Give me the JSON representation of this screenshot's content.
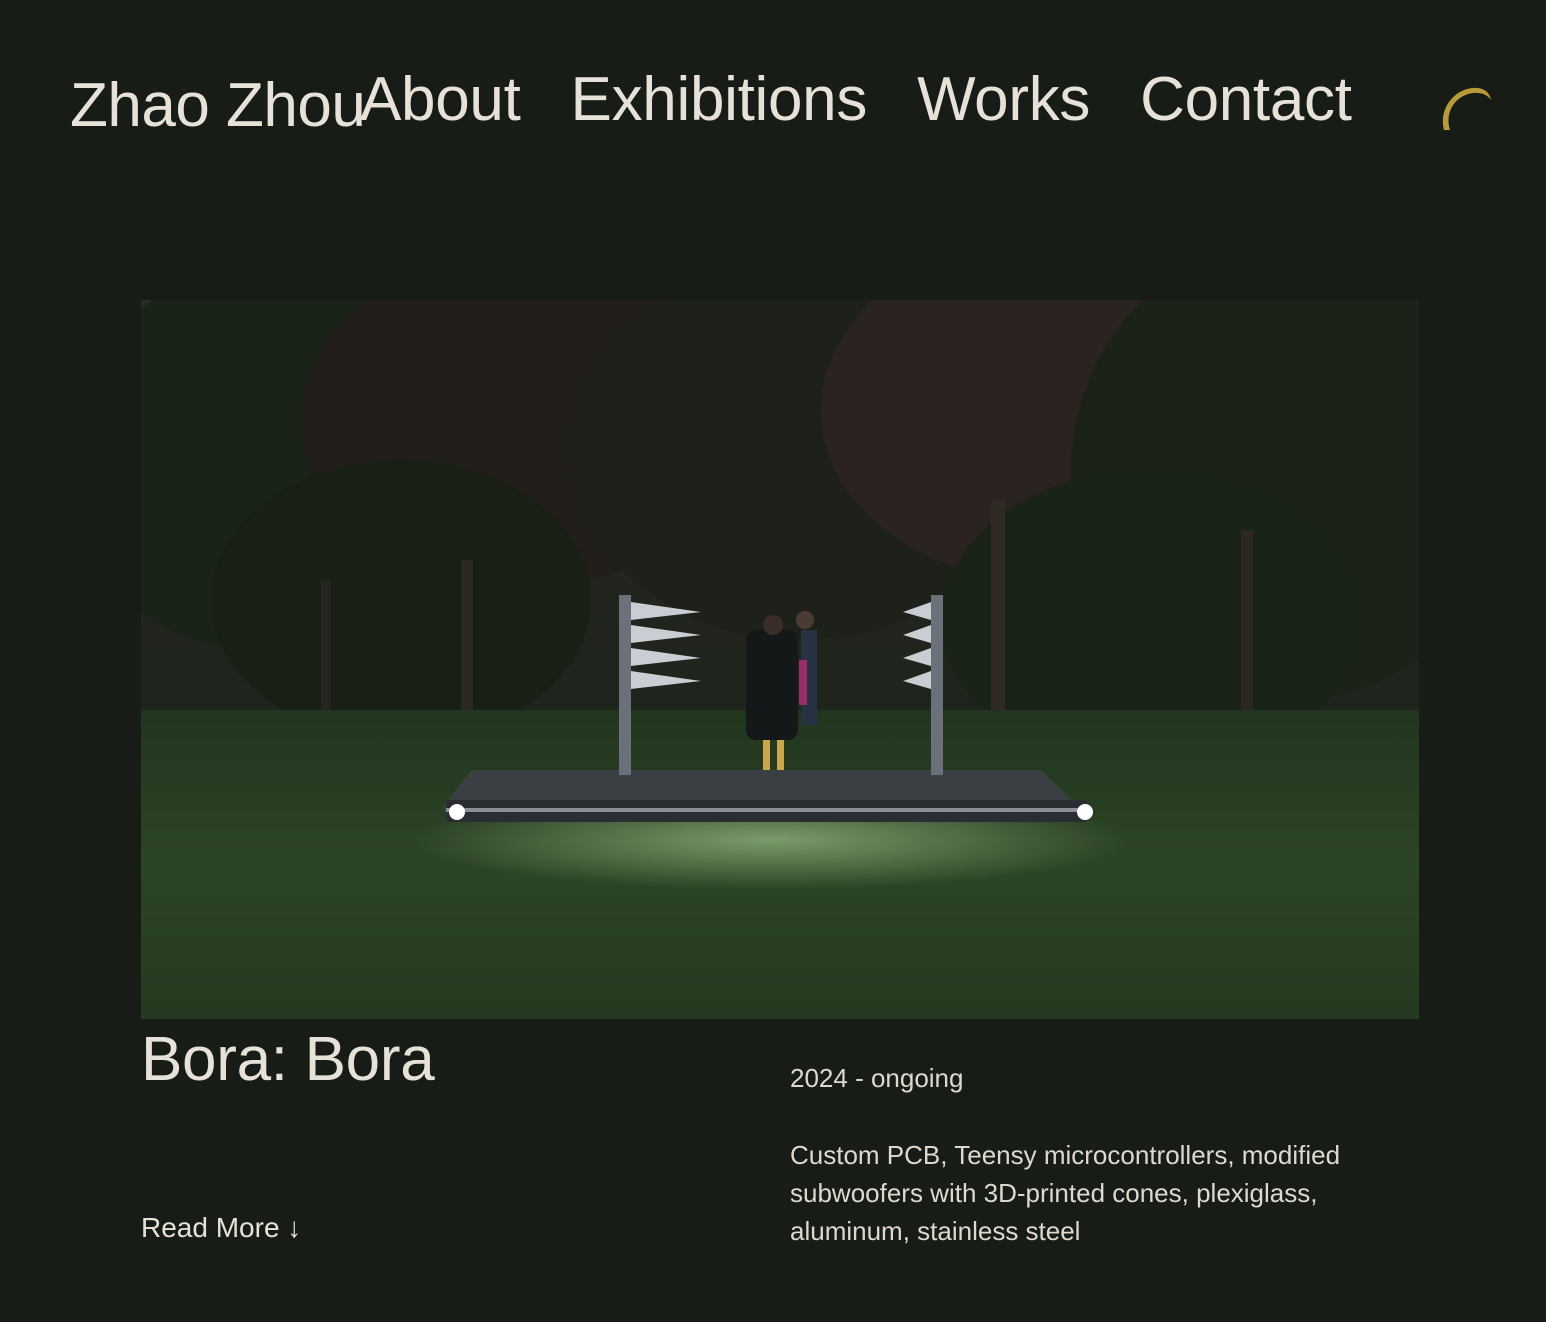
{
  "header": {
    "logo": "Zhao Zhou",
    "nav": [
      "About",
      "Exhibitions",
      "Works",
      "Contact"
    ],
    "theme_icon": "crescent-moon-icon"
  },
  "work": {
    "title": "Bora: Bora",
    "year": "2024 - ongoing",
    "materials": "Custom PCB, Teensy microcontrollers, modified subwoofers with 3D-printed cones, plexiglass, aluminum, stainless steel",
    "read_more": "Read More ↓"
  },
  "colors": {
    "background": "#181c17",
    "text": "#e6e2d8",
    "accent": "#b89a3a"
  }
}
